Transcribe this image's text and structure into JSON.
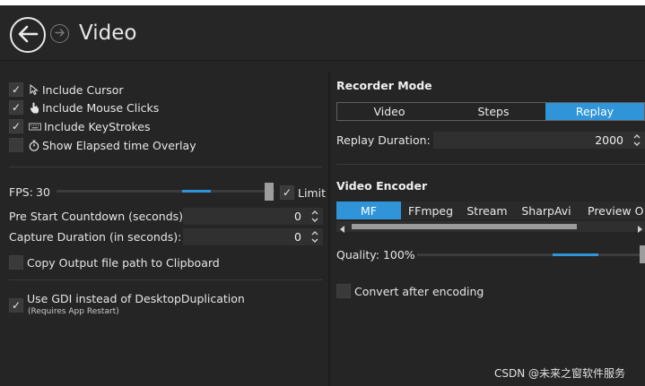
{
  "header": {
    "title": "Video"
  },
  "left": {
    "checkboxes": [
      {
        "label": "Include Cursor",
        "checked": true,
        "icon": "cursor-icon"
      },
      {
        "label": "Include Mouse Clicks",
        "checked": true,
        "icon": "hand-pointer-icon"
      },
      {
        "label": "Include KeyStrokes",
        "checked": true,
        "icon": "keyboard-icon"
      },
      {
        "label": "Show Elapsed time Overlay",
        "checked": false,
        "icon": "stopwatch-icon"
      }
    ],
    "fps": {
      "label": "FPS:",
      "value": "30",
      "slider_fraction": 0.95,
      "limit_label": "Limit",
      "limit_checked": true
    },
    "pre_start": {
      "label": "Pre Start Countdown (seconds):",
      "value": "0"
    },
    "capture_duration": {
      "label": "Capture Duration (in seconds):",
      "value": "0"
    },
    "copy_path": {
      "label": "Copy Output file path to Clipboard",
      "checked": false
    },
    "gdi": {
      "label": "Use GDI instead of DesktopDuplication",
      "note": "(Requires App Restart)",
      "checked": true
    }
  },
  "right": {
    "recorder_mode": {
      "title": "Recorder Mode",
      "options": [
        "Video",
        "Steps",
        "Replay"
      ],
      "selected": "Replay"
    },
    "replay_duration": {
      "label": "Replay Duration:",
      "value": "2000"
    },
    "video_encoder": {
      "title": "Video Encoder",
      "tabs": [
        "MF",
        "FFmpeg",
        "Stream",
        "SharpAvi",
        "Preview O"
      ],
      "selected": "MF"
    },
    "quality": {
      "label": "Quality: 100%",
      "value_percent": 100
    },
    "convert": {
      "label": "Convert after encoding",
      "checked": false
    }
  },
  "watermark": "CSDN @未来之窗软件服务",
  "colors": {
    "accent": "#2f94d8",
    "background": "#252525"
  }
}
